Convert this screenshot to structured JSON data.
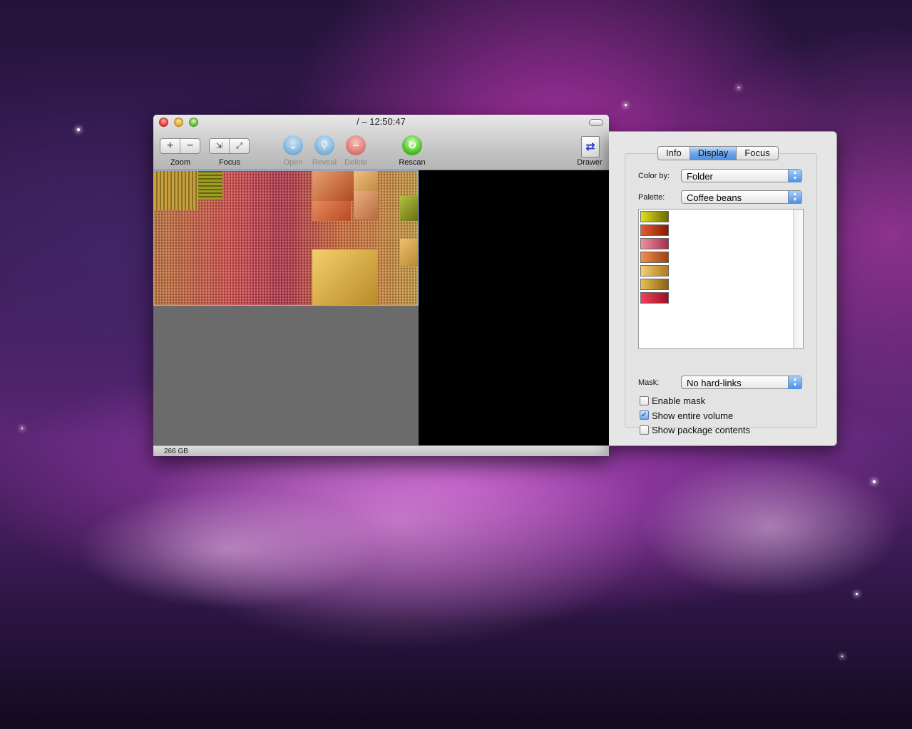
{
  "window": {
    "title": "/ – 12:50:47",
    "toolbar": {
      "zoom_label": "Zoom",
      "zoom_in": "+",
      "zoom_out": "−",
      "focus_label": "Focus",
      "open_label": "Open",
      "reveal_label": "Reveal",
      "delete_label": "Delete",
      "rescan_label": "Rescan",
      "drawer_label": "Drawer"
    },
    "status": "266 GB"
  },
  "drawer": {
    "tabs": [
      "Info",
      "Display",
      "Focus"
    ],
    "active_tab": "Display",
    "color_by_label": "Color by:",
    "color_by_value": "Folder",
    "palette_label": "Palette:",
    "palette_value": "Coffee beans",
    "palette_swatches": [
      "#8a8a10",
      "#b8360f",
      "#c86070",
      "#c8652c",
      "#d8a040",
      "#b88628",
      "#cc2240"
    ],
    "mask_label": "Mask:",
    "mask_value": "No hard-links",
    "checkboxes": [
      {
        "label": "Enable mask",
        "checked": false
      },
      {
        "label": "Show entire volume",
        "checked": true
      },
      {
        "label": "Show package contents",
        "checked": false
      }
    ]
  },
  "colors": {
    "treemap_accent": "#d4a040",
    "window_bg": "#ededed"
  }
}
